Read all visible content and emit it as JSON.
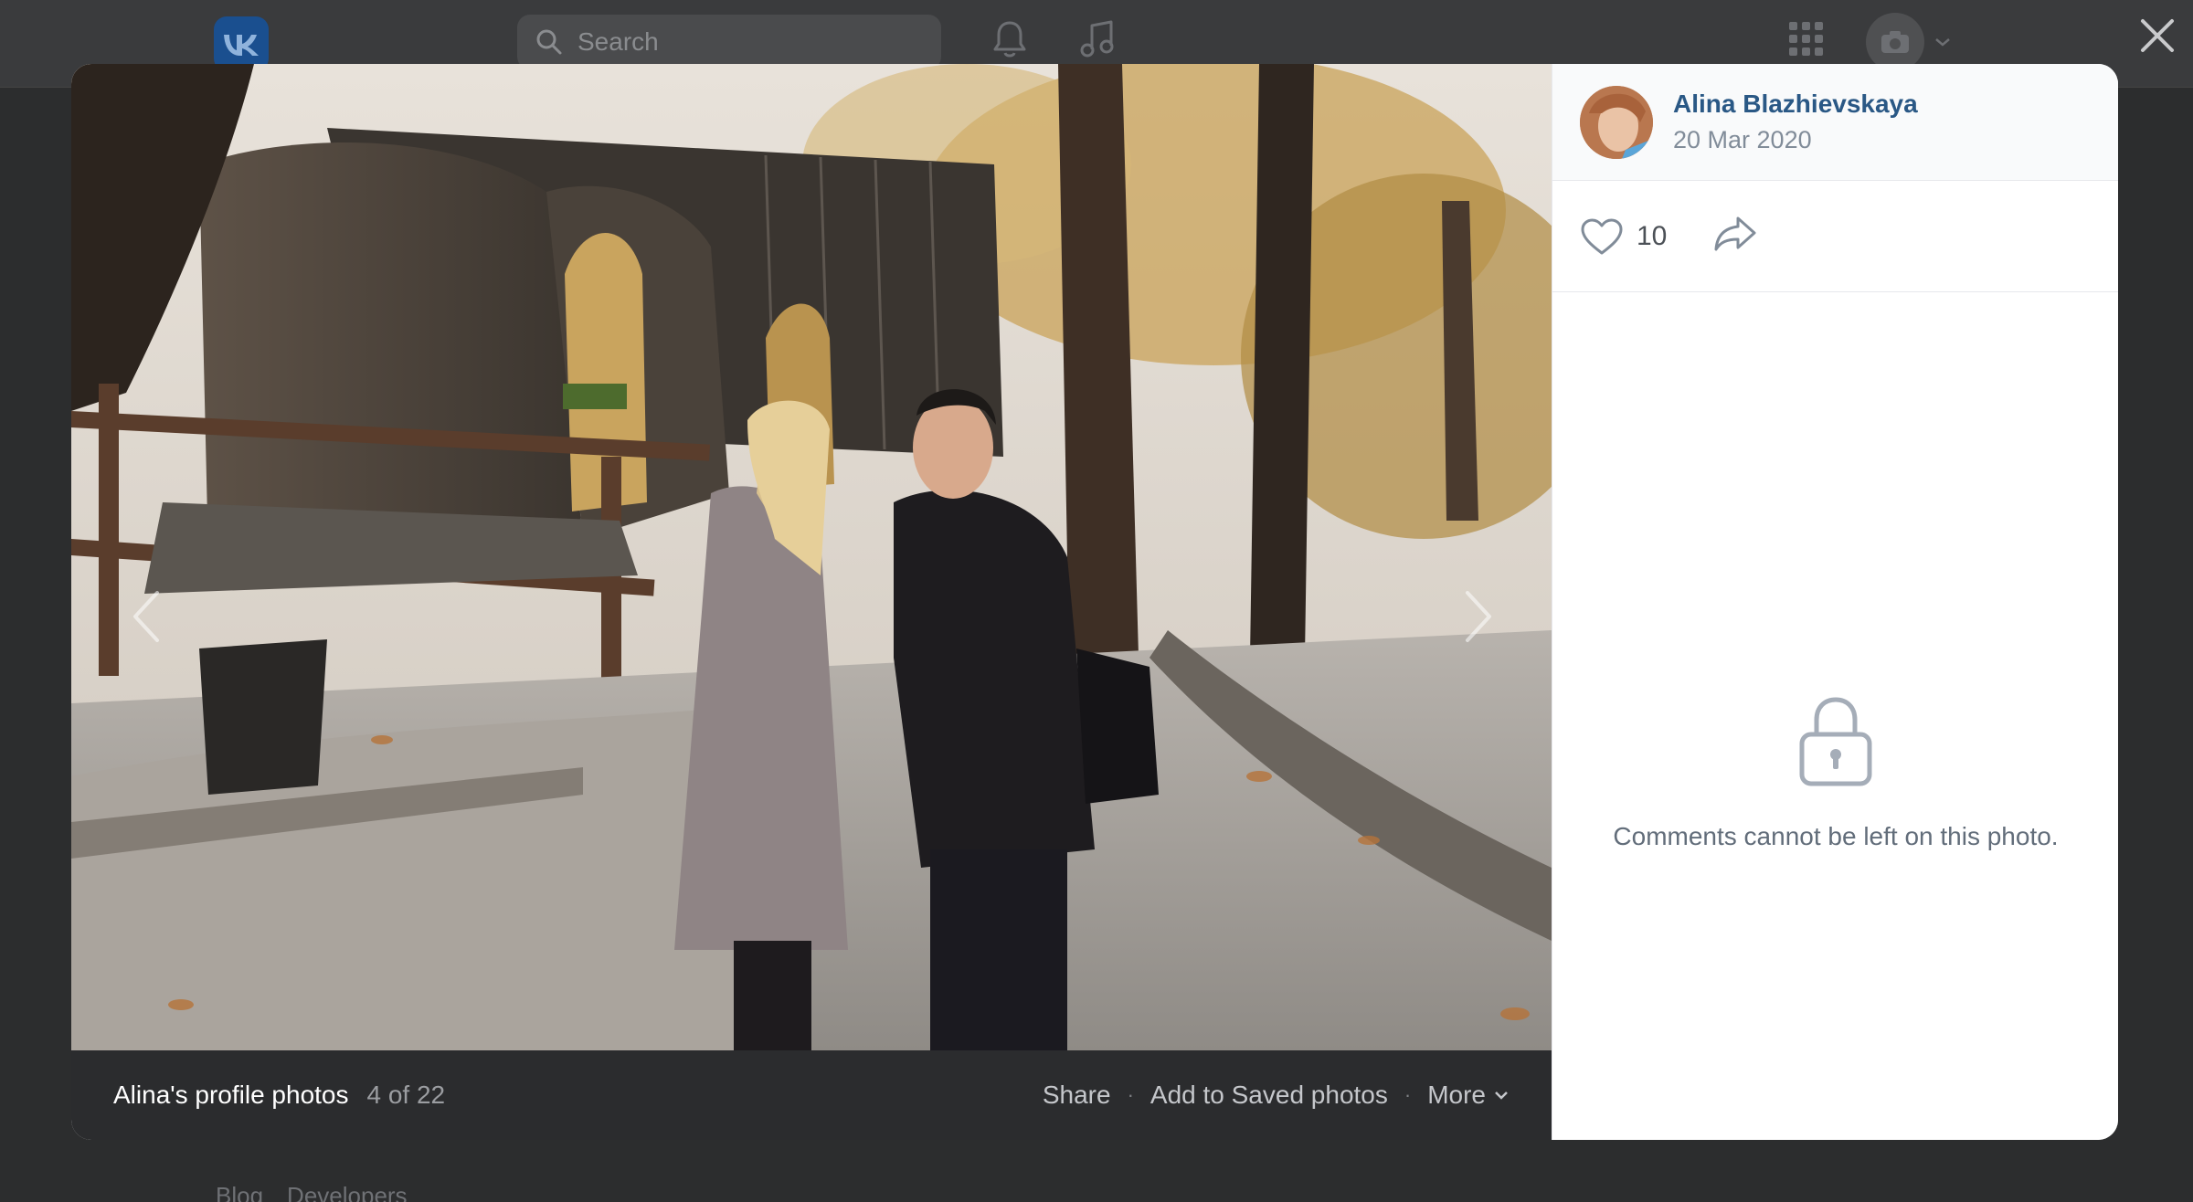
{
  "header": {
    "logo_text": "VK",
    "search_placeholder": "Search",
    "icons": [
      "vk-logo-icon",
      "search-icon",
      "bell-icon",
      "music-icon",
      "apps-grid-icon",
      "camera-icon",
      "chevron-down-icon"
    ]
  },
  "background_footer": [
    "Blog",
    "Developers"
  ],
  "viewer": {
    "album_title": "Alina's profile photos",
    "position_text": "4 of 22",
    "actions": {
      "share": "Share",
      "save": "Add to Saved photos",
      "more": "More"
    },
    "separator": "·"
  },
  "side_panel": {
    "author_name": "Alina Blazhievskaya",
    "date": "20 Mar 2020",
    "likes": "10",
    "comments_locked_text": "Comments cannot be left on this photo."
  },
  "colors": {
    "link": "#2a5885",
    "muted": "#818c99",
    "caption_bg": "#2b2c2e",
    "backdrop": "#2c2d2e"
  }
}
